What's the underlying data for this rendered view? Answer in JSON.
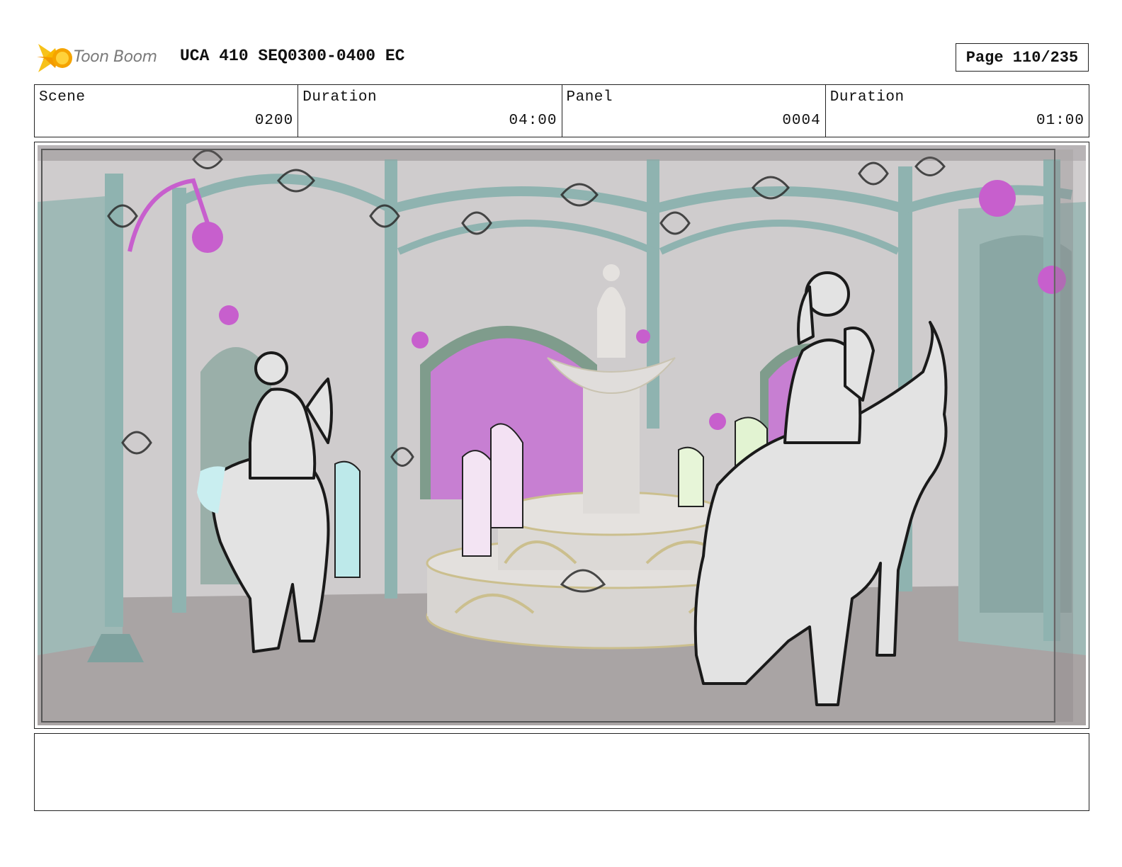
{
  "header": {
    "logo_text": "Toon Boom",
    "title": "UCA 410 SEQ0300-0400 EC",
    "page": "Page 110/235"
  },
  "info": {
    "scene_label": "Scene",
    "scene_value": "0200",
    "scene_duration_label": "Duration",
    "scene_duration_value": "04:00",
    "panel_label": "Panel",
    "panel_value": "0004",
    "panel_duration_label": "Duration",
    "panel_duration_value": "01:00"
  },
  "notes": {
    "text": ""
  },
  "colors": {
    "wall": "#c9c7c8",
    "floor": "#aaa5a5",
    "teal": "#8fb3b0",
    "magenta": "#c97ad4",
    "sketch_fill": "#e3e3e3",
    "sketch_line": "#1a1a1a"
  }
}
